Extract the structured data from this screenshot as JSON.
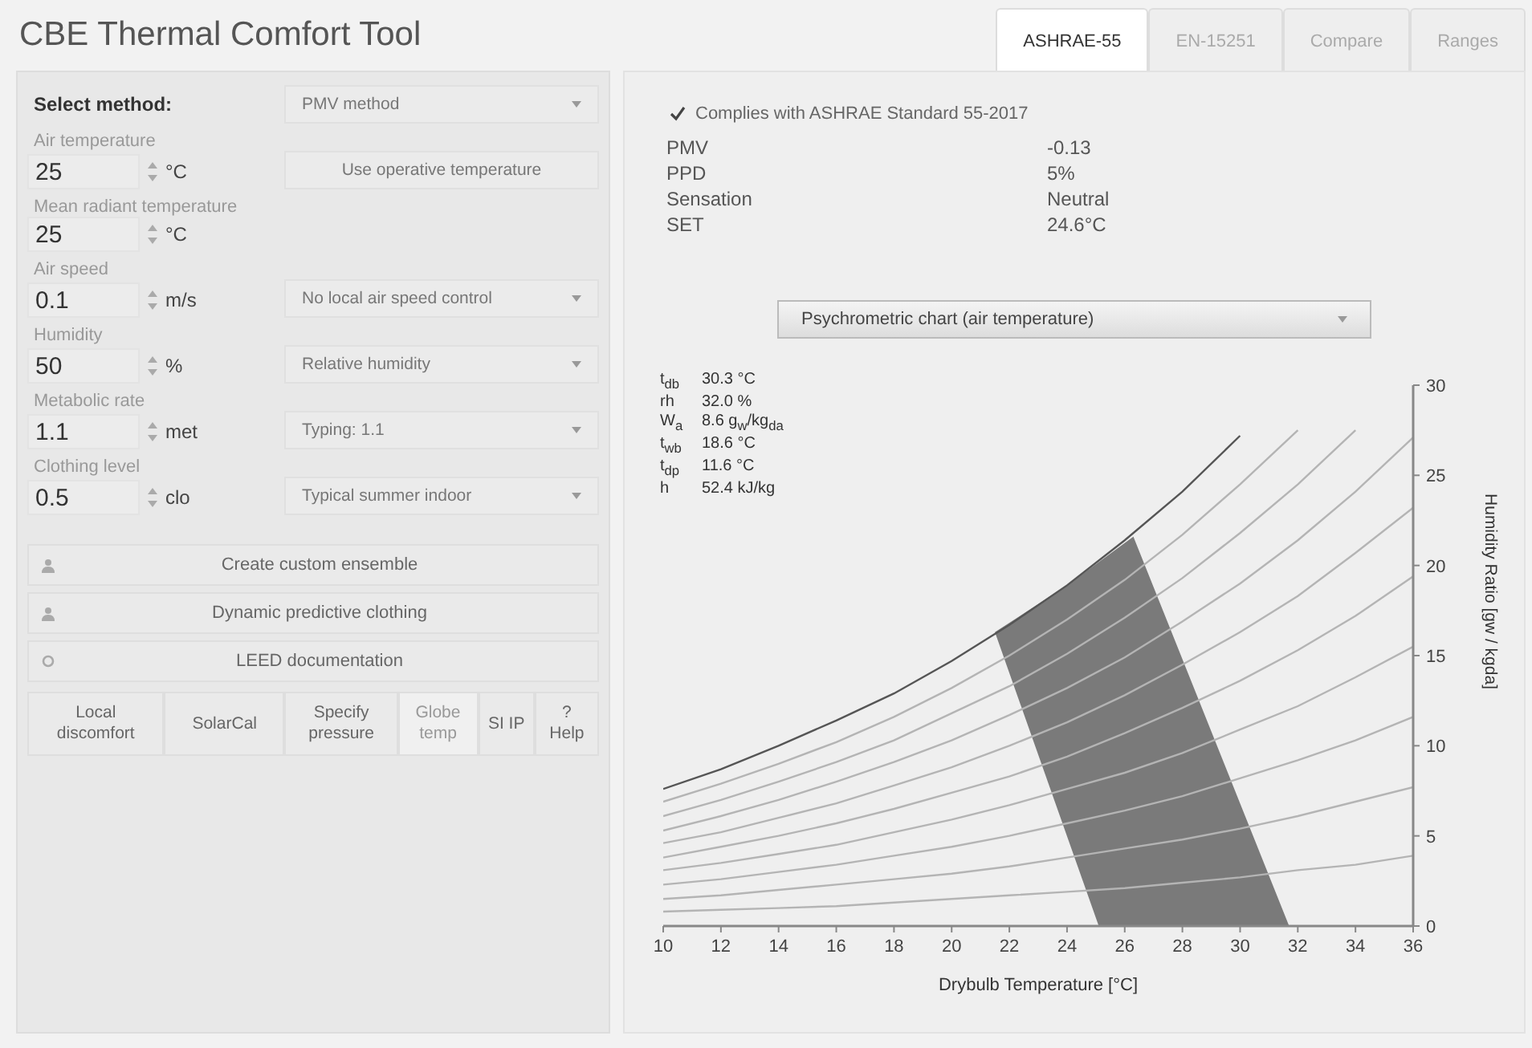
{
  "header": {
    "title": "CBE Thermal Comfort Tool"
  },
  "tabs": [
    {
      "label": "ASHRAE-55",
      "selected": true
    },
    {
      "label": "EN-15251",
      "selected": false
    },
    {
      "label": "Compare",
      "selected": false
    },
    {
      "label": "Ranges",
      "selected": false
    }
  ],
  "method": {
    "label": "Select method:",
    "value": "PMV method"
  },
  "inputs": [
    {
      "label": "Air temperature",
      "value": "25",
      "unit": "°C",
      "control": {
        "kind": "button",
        "label": "Use operative temperature"
      }
    },
    {
      "label": "Mean radiant temperature",
      "value": "25",
      "unit": "°C"
    },
    {
      "label": "Air speed",
      "value": "0.1",
      "unit": "m/s",
      "control": {
        "kind": "dropdown",
        "label": "No local air speed control"
      }
    },
    {
      "label": "Humidity",
      "value": "50",
      "unit": "%",
      "control": {
        "kind": "dropdown",
        "label": "Relative humidity"
      }
    },
    {
      "label": "Metabolic rate",
      "value": "1.1",
      "unit": "met",
      "control": {
        "kind": "dropdown",
        "label": "Typing: 1.1"
      }
    },
    {
      "label": "Clothing level",
      "value": "0.5",
      "unit": "clo",
      "control": {
        "kind": "dropdown",
        "label": "Typical summer indoor"
      }
    }
  ],
  "actions": [
    {
      "label": "Create custom ensemble"
    },
    {
      "label": "Dynamic predictive clothing"
    },
    {
      "label": "LEED documentation"
    }
  ],
  "tools": [
    {
      "label": "Local discomfort",
      "disabled": false
    },
    {
      "label": "SolarCal",
      "disabled": false
    },
    {
      "label": "Specify pressure",
      "disabled": false
    },
    {
      "label": "Globe temp",
      "disabled": true
    },
    {
      "label": "SI IP",
      "disabled": false
    },
    {
      "label": "? Help",
      "disabled": false
    }
  ],
  "compliance": {
    "text": "Complies with ASHRAE Standard 55-2017",
    "complies": true
  },
  "results": [
    {
      "label": "PMV",
      "value": "-0.13"
    },
    {
      "label": "PPD",
      "value": "5%"
    },
    {
      "label": "Sensation",
      "value": "Neutral"
    },
    {
      "label": "SET",
      "value": "24.6°C"
    }
  ],
  "chart_select": {
    "value": "Psychrometric chart (air temperature)"
  },
  "chart_info": [
    {
      "label": "t$_{db}$",
      "value": "30.3 °C"
    },
    {
      "label": "rh",
      "value": "32.0 %"
    },
    {
      "label": "W$_{a}$",
      "value": "8.6  g$_{w}$/kg$_{da}$"
    },
    {
      "label": "t$_{wb}$",
      "value": "18.6 °C"
    },
    {
      "label": "t$_{dp}$",
      "value": "11.6 °C"
    },
    {
      "label": "h",
      "value": "52.4 kJ/kg"
    }
  ],
  "chart_data": {
    "type": "line",
    "xlabel": "Drybulb Temperature [°C]",
    "ylabel": "Humidity Ratio [gw / kgda]",
    "x": [
      10,
      12,
      14,
      16,
      18,
      20,
      22,
      24,
      26,
      28,
      30,
      32,
      34,
      36
    ],
    "xlim": [
      10,
      36
    ],
    "ylim": [
      0,
      30
    ],
    "xticks": [
      10,
      12,
      14,
      16,
      18,
      20,
      22,
      24,
      26,
      28,
      30,
      32,
      34,
      36
    ],
    "yticks": [
      0,
      5,
      10,
      15,
      20,
      25,
      30
    ],
    "series": [
      {
        "color": "#b4b4b4",
        "values": [
          0.8,
          0.9,
          1.0,
          1.1,
          1.3,
          1.5,
          1.7,
          1.9,
          2.1,
          2.4,
          2.7,
          3.1,
          3.4,
          3.9
        ]
      },
      {
        "color": "#b4b4b4",
        "values": [
          1.5,
          1.7,
          2.0,
          2.3,
          2.6,
          2.9,
          3.3,
          3.8,
          4.3,
          4.8,
          5.4,
          6.1,
          6.9,
          7.7
        ]
      },
      {
        "color": "#b4b4b4",
        "values": [
          2.3,
          2.6,
          3.0,
          3.4,
          3.9,
          4.4,
          5.0,
          5.7,
          6.4,
          7.2,
          8.2,
          9.2,
          10.3,
          11.6
        ]
      },
      {
        "color": "#b4b4b4",
        "values": [
          3.1,
          3.5,
          4.0,
          4.5,
          5.2,
          5.9,
          6.7,
          7.6,
          8.5,
          9.6,
          10.9,
          12.2,
          13.8,
          15.5
        ]
      },
      {
        "color": "#b4b4b4",
        "values": [
          3.8,
          4.4,
          5.0,
          5.7,
          6.5,
          7.4,
          8.3,
          9.4,
          10.7,
          12.1,
          13.6,
          15.3,
          17.2,
          19.4
        ]
      },
      {
        "color": "#b4b4b4",
        "values": [
          4.6,
          5.2,
          6.0,
          6.8,
          7.8,
          8.8,
          10.0,
          11.3,
          12.8,
          14.5,
          16.3,
          18.3,
          20.7,
          23.2
        ]
      },
      {
        "color": "#b4b4b4",
        "values": [
          5.3,
          6.1,
          7.0,
          8.0,
          9.1,
          10.3,
          11.7,
          13.2,
          14.9,
          16.9,
          19.0,
          21.4,
          24.1,
          27.1
        ]
      },
      {
        "color": "#b4b4b4",
        "values": [
          6.1,
          7.0,
          8.0,
          9.1,
          10.3,
          11.8,
          13.3,
          15.1,
          17.1,
          19.3,
          21.8,
          24.5,
          27.5,
          null
        ]
      },
      {
        "color": "#b4b4b4",
        "values": [
          6.9,
          7.9,
          9.0,
          10.2,
          11.6,
          13.2,
          15.0,
          17.0,
          19.2,
          21.7,
          24.5,
          27.5,
          null,
          null
        ]
      },
      {
        "color": "#555555",
        "values": [
          7.6,
          8.7,
          10.0,
          11.4,
          12.9,
          14.7,
          16.7,
          18.9,
          21.4,
          24.1,
          27.2,
          null,
          null,
          null
        ]
      }
    ]
  }
}
